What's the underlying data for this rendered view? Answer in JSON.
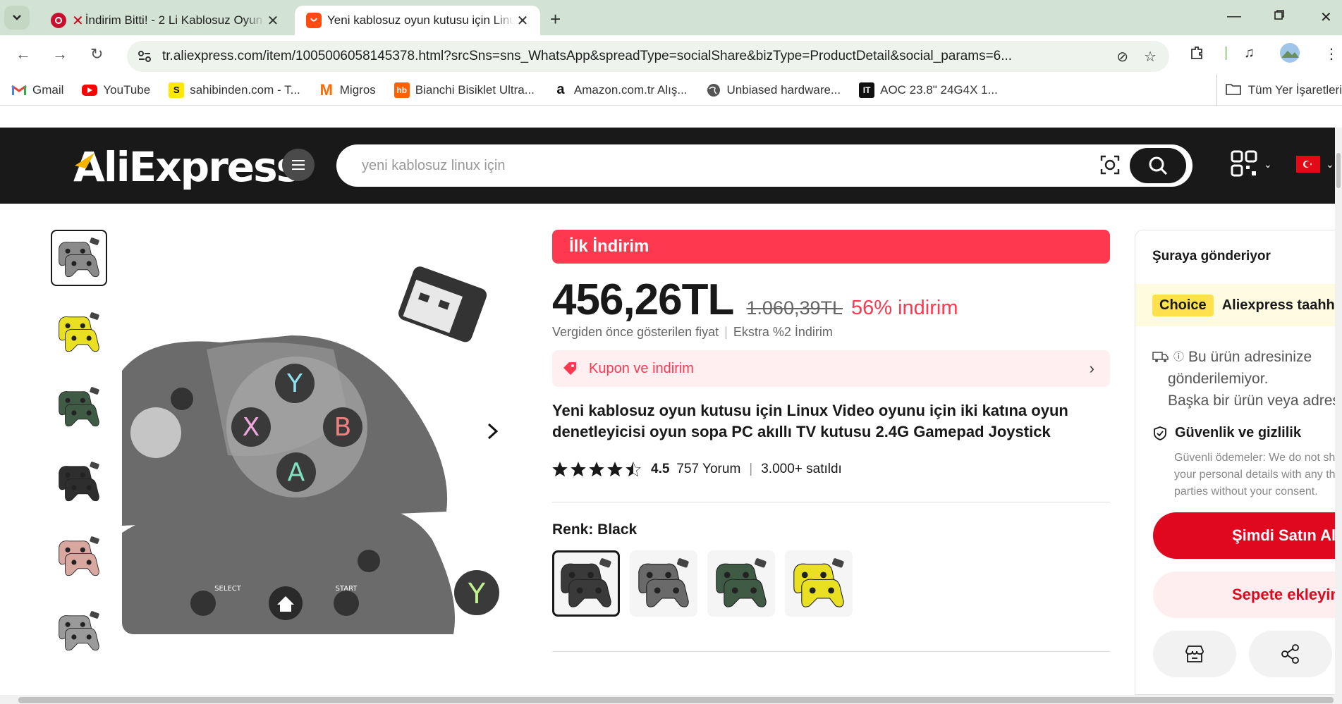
{
  "browser": {
    "tabs": [
      {
        "title": "İndirim Bitti! - 2 Li Kablosuz Oyun",
        "active": false
      },
      {
        "title": "Yeni kablosuz oyun kutusu için Linux",
        "active": true
      }
    ],
    "url": "tr.aliexpress.com/item/1005006058145378.html?srcSns=sns_WhatsApp&spreadType=socialShare&bizType=ProductDetail&social_params=6...",
    "bookmarks": [
      {
        "label": "Gmail",
        "icon": "gmail-icon"
      },
      {
        "label": "YouTube",
        "icon": "youtube-icon"
      },
      {
        "label": "sahibinden.com - T...",
        "icon": "sahibinden-icon"
      },
      {
        "label": "Migros",
        "icon": "migros-icon"
      },
      {
        "label": "Bianchi Bisiklet Ultra...",
        "icon": "hepsiburada-icon"
      },
      {
        "label": "Amazon.com.tr Alış...",
        "icon": "amazon-icon"
      },
      {
        "label": "Unbiased hardware...",
        "icon": "globe-icon"
      },
      {
        "label": "AOC 23.8\" 24G4X 1...",
        "icon": "itopya-icon"
      }
    ],
    "bookmarks_folder": "Tüm Yer İşaretleri"
  },
  "header": {
    "logo": "AliExpress",
    "search_placeholder": "yeni kablosuz linux için"
  },
  "product": {
    "promo_label": "İlk İndirim",
    "price": "456,26TL",
    "old_price": "1.060,39TL",
    "discount": "56% indirim",
    "price_note": "Vergiden önce gösterilen fiyat",
    "extra_discount": "Ekstra %2 İndirim",
    "coupon_label": "Kupon ve indirim",
    "title": "Yeni kablosuz oyun kutusu için Linux Video oyunu için iki katına oyun denetleyicisi oyun sopa PC akıllı TV kutusu 2.4G Gamepad Joystick",
    "rating": "4.5",
    "reviews": "757 Yorum",
    "sold": "3.000+ satıldı",
    "color_label": "Renk: Black",
    "swatch_colors": [
      "#3a3a3a",
      "#6a6a6a",
      "#3f5a45",
      "#e8e021"
    ],
    "thumb_accents": [
      "#8a8a8a",
      "#e8e021",
      "#3f5a45",
      "#2e2e2e",
      "#d8a7a0",
      "#9a9a9a"
    ]
  },
  "sidebar": {
    "ship_title": "Şuraya gönderiyor",
    "choice_badge": "Choice",
    "choice_text": "Aliexpress taahhüdü",
    "no_ship_line1": "Bu ürün adresinize",
    "no_ship_line2": "gönderilemiyor.",
    "no_ship_line3": "Başka bir ürün veya adres",
    "security_title": "Güvenlik ve gizlilik",
    "security_text": "Güvenli ödemeler: We do not share your personal details with any third parties without your consent.",
    "buy_now": "Şimdi Satın Al",
    "add_to_cart": "Sepete ekleyin"
  },
  "colors": {
    "brand_red": "#fd384f",
    "buy_red": "#e0081f",
    "header_bg": "#191919",
    "tabbar_bg": "#d3e3d3"
  }
}
